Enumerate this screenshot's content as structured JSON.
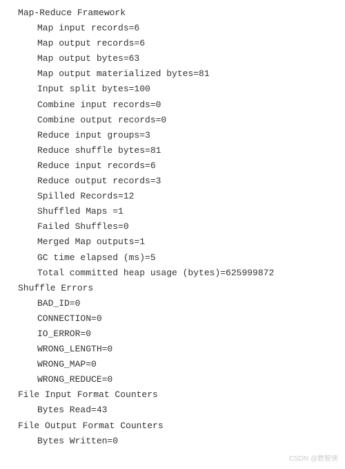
{
  "sections": {
    "mapreduce": {
      "header": "Map-Reduce Framework",
      "metrics": {
        "map_input_records": "Map input records=6",
        "map_output_records": "Map output records=6",
        "map_output_bytes": "Map output bytes=63",
        "map_output_materialized_bytes": "Map output materialized bytes=81",
        "input_split_bytes": "Input split bytes=100",
        "combine_input_records": "Combine input records=0",
        "combine_output_records": "Combine output records=0",
        "reduce_input_groups": "Reduce input groups=3",
        "reduce_shuffle_bytes": "Reduce shuffle bytes=81",
        "reduce_input_records": "Reduce input records=6",
        "reduce_output_records": "Reduce output records=3",
        "spilled_records": "Spilled Records=12",
        "shuffled_maps": "Shuffled Maps =1",
        "failed_shuffles": "Failed Shuffles=0",
        "merged_map_outputs": "Merged Map outputs=1",
        "gc_time_elapsed": "GC time elapsed (ms)=5",
        "total_committed_heap": "Total committed heap usage (bytes)=625999872"
      }
    },
    "shuffle_errors": {
      "header": "Shuffle Errors",
      "metrics": {
        "bad_id": "BAD_ID=0",
        "connection": "CONNECTION=0",
        "io_error": "IO_ERROR=0",
        "wrong_length": "WRONG_LENGTH=0",
        "wrong_map": "WRONG_MAP=0",
        "wrong_reduce": "WRONG_REDUCE=0"
      }
    },
    "file_input": {
      "header": "File Input Format Counters",
      "metrics": {
        "bytes_read": "Bytes Read=43"
      }
    },
    "file_output": {
      "header": "File Output Format Counters",
      "metrics": {
        "bytes_written": "Bytes Written=0"
      }
    }
  },
  "watermark": "CSDN @数智侠"
}
